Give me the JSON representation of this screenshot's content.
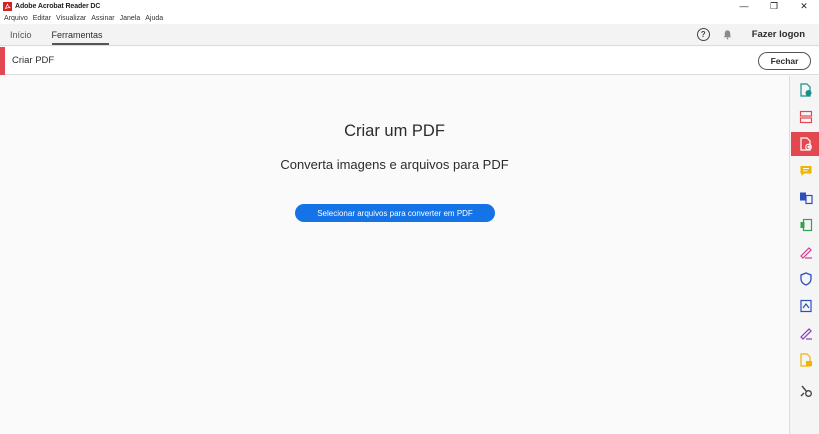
{
  "window": {
    "title": "Adobe Acrobat Reader DC",
    "controls": {
      "minimize": "—",
      "restore": "❐",
      "close": "✕"
    }
  },
  "menubar": {
    "items": [
      "Arquivo",
      "Editar",
      "Visualizar",
      "Assinar",
      "Janela",
      "Ajuda"
    ]
  },
  "tabs": {
    "items": [
      "Início",
      "Ferramentas"
    ],
    "active": "Ferramentas",
    "help_symbol": "?",
    "login_label": "Fazer logon"
  },
  "tool": {
    "title": "Criar PDF",
    "close_label": "Fechar",
    "accent_color": "#e34850"
  },
  "main": {
    "heading": "Criar um PDF",
    "subheading": "Converta imagens e arquivos para PDF",
    "select_button_label": "Selecionar arquivos para converter em PDF",
    "button_color": "#1473e6"
  },
  "right_toolbar": {
    "items": [
      {
        "icon": "export-pdf-icon",
        "color": "#14918b"
      },
      {
        "icon": "organize-pages-icon",
        "color": "#e34850"
      },
      {
        "icon": "create-pdf-icon",
        "color": "#ffffff",
        "active": true
      },
      {
        "icon": "comment-icon",
        "color": "#f0b500"
      },
      {
        "icon": "combine-files-icon",
        "color": "#2d4fbe"
      },
      {
        "icon": "edit-pdf-icon",
        "color": "#31a54b"
      },
      {
        "icon": "fill-sign-icon",
        "color": "#d83790"
      },
      {
        "icon": "protect-icon",
        "color": "#2d4fbe"
      },
      {
        "icon": "optimize-pdf-icon",
        "color": "#2d4fbe"
      },
      {
        "icon": "send-for-signature-icon",
        "color": "#7e3dbf"
      },
      {
        "icon": "send-for-comments-icon",
        "color": "#f0b500"
      },
      {
        "icon": "more-tools-icon",
        "color": "#444444"
      }
    ]
  }
}
